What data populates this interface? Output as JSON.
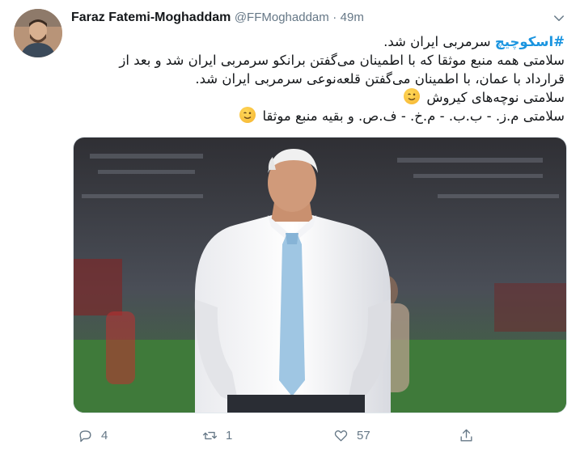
{
  "tweet": {
    "author_name": "Faraz Fatemi-Moghaddam",
    "handle": "@FFMoghaddam",
    "separator": "·",
    "time": "49m",
    "hashtag": "#اسکوچیچ",
    "line1_rest": " سرمربی ایران شد.",
    "line2": "سلامتی همه منبع موثقا که با اطمینان می‌گفتن برانکو سرمربی ایران شد و بعد از",
    "line3": "قرارداد با عمان، با اطمینان می‌گفتن قلعه‌نوعی سرمربی ایران شد.",
    "line4": "سلامتی نوچه‌های کیروش",
    "line5": "سلامتی م.ز. - ب.ب. - م.خ. - ف.ص. و بقیه منبع موثقا"
  },
  "actions": {
    "reply_count": "4",
    "retweet_count": "1",
    "like_count": "57"
  },
  "icons": {
    "avatar": "profile-photo",
    "caret": "chevron-down-icon",
    "reply": "reply-icon",
    "retweet": "retweet-icon",
    "like": "heart-icon",
    "share": "share-icon",
    "emoji": "winking-face-emoji"
  },
  "colors": {
    "hashtag": "#1b95e0",
    "muted": "#657786",
    "text": "#14171a"
  }
}
